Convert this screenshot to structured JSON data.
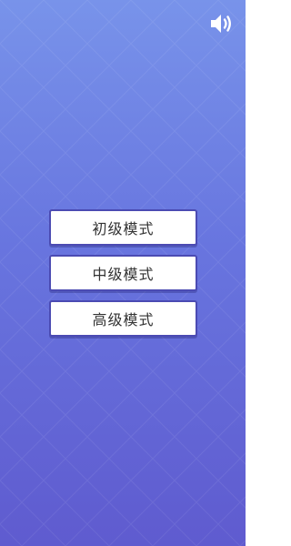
{
  "sound": {
    "icon": "speaker-volume-icon",
    "color": "#ffffff"
  },
  "menu": {
    "buttons": [
      {
        "label": "初级模式"
      },
      {
        "label": "中级模式"
      },
      {
        "label": "高级模式"
      }
    ]
  },
  "colors": {
    "background_top": "#7893ea",
    "background_bottom": "#5f5bcf",
    "button_bg": "#ffffff",
    "button_border": "#4b4bb3",
    "button_text": "#333333"
  }
}
